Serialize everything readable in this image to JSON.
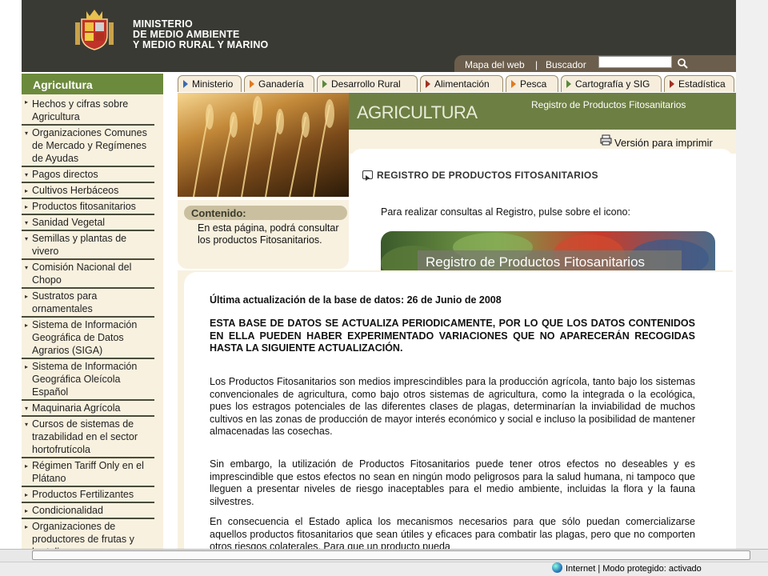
{
  "header": {
    "ministry_line1": "MINISTERIO",
    "ministry_line2": "DE MEDIO AMBIENTE",
    "ministry_line3": "Y MEDIO RURAL Y MARINO",
    "links": [
      "Mapa del web",
      "|",
      "Buscador"
    ],
    "search_value": ""
  },
  "sidebar": {
    "title": "Agricultura",
    "items": [
      {
        "label": "Hechos y cifras sobre Agricultura",
        "tri": "▸"
      },
      {
        "label": "Organizaciones Comunes de Mercado y Regímenes de Ayudas",
        "tri": "▾"
      },
      {
        "label": "Pagos directos",
        "tri": "▾"
      },
      {
        "label": "Cultivos Herbáceos",
        "tri": "▸"
      },
      {
        "label": "Productos fitosanitarios",
        "tri": "▸"
      },
      {
        "label": "Sanidad Vegetal",
        "tri": "▾"
      },
      {
        "label": "Semillas y plantas de vivero",
        "tri": "▾"
      },
      {
        "label": "Comisión Nacional del Chopo",
        "tri": "▾"
      },
      {
        "label": "Sustratos para ornamentales",
        "tri": "▸"
      },
      {
        "label": "Sistema de Información Geográfica de Datos Agrarios (SIGA)",
        "tri": "▸"
      },
      {
        "label": "Sistema de Información Geográfica Oleícola Español",
        "tri": "▸"
      },
      {
        "label": "Maquinaria Agrícola",
        "tri": "▾"
      },
      {
        "label": "Cursos de sistemas de trazabilidad en el sector hortofrutícola",
        "tri": "▾"
      },
      {
        "label": "Régimen Tariff Only en el Plátano",
        "tri": "▸"
      },
      {
        "label": "Productos Fertilizantes",
        "tri": "▸"
      },
      {
        "label": "Condicionalidad",
        "tri": "▸"
      },
      {
        "label": "Organizaciones de productores de frutas y hortalizas",
        "tri": "▸"
      }
    ]
  },
  "tabs": [
    "Ministerio",
    "Ganadería",
    "Desarrollo Rural",
    "Alimentación",
    "Pesca",
    "Cartografía y SIG",
    "Estadística"
  ],
  "banner": {
    "section": "AGRICULTURA",
    "subtitle": "Registro de Productos Fitosanitarios"
  },
  "print_label": "Versión para imprimir",
  "contenido": {
    "label": "Contenido:",
    "text": "En esta página, podrá consultar los productos Fitosanitarios."
  },
  "section_heading": "REGISTRO DE PRODUCTOS FITOSANITARIOS",
  "consult_text": "Para realizar consultas al Registro, pulse sobre el icono:",
  "reg_banner_label": "Registro de Productos Fitosanitarios",
  "body": {
    "updated": "Última actualización de la base de datos: 26 de Junio de 2008",
    "warning": "ESTA BASE DE DATOS SE ACTUALIZA PERIODICAMENTE, POR LO QUE LOS DATOS CONTENIDOS EN ELLA PUEDEN HABER EXPERIMENTADO VARIACIONES QUE NO APARECERÁN RECOGIDAS HASTA LA SIGUIENTE ACTUALIZACIÓN.",
    "para1": "Los Productos Fitosanitarios son medios imprescindibles para la producción agrícola, tanto bajo los sistemas convencionales de agricultura, como bajo otros sistemas de agricultura, como la integrada o la ecológica, pues los estragos potenciales de las diferentes clases de plagas, determinarían la inviabilidad de muchos cultivos en las zonas de producción de mayor interés económico y social e incluso la posibilidad de mantener almacenadas las cosechas.",
    "para2": "Sin embargo, la utilización de Productos Fitosanitarios puede tener otros efectos no deseables y es imprescindible que estos efectos no sean en ningún modo peligrosos para la salud humana, ni tampoco que lleguen a presentar niveles de riesgo inaceptables para el medio ambiente, incluidas la flora y la fauna silvestres.",
    "para3": "En consecuencia el Estado aplica los mecanismos necesarios para que sólo puedan comercializarse aquellos productos fitosanitarios que sean útiles y eficaces para combatir las plagas, pero que no comporten otros riesgos colaterales. Para que un producto pueda"
  },
  "status": {
    "zone": "Internet | Modo protegido: activado"
  },
  "colors": {
    "header_bg": "#3a3a34",
    "accent_green": "#6c8a3c",
    "banner_green": "#6e7f44",
    "cream": "#f8f1df"
  }
}
